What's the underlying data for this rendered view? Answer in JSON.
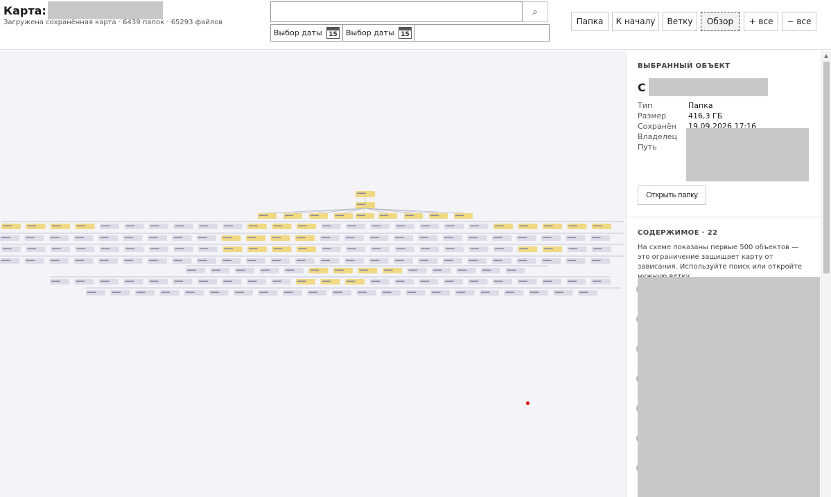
{
  "header": {
    "title": "Карта:",
    "subtitle": "Загружена сохранённая карта · 6439 папок · 65293 файлов",
    "search": {
      "value": "",
      "placeholder": "",
      "button_icon": "search-icon",
      "button_glyph": "⌕"
    },
    "date_from": {
      "label": "Выбор даты",
      "icon": "calendar-icon",
      "day": "15"
    },
    "date_to": {
      "label": "Выбор даты",
      "icon": "calendar-icon",
      "day": "15"
    }
  },
  "toolbar": {
    "buttons": [
      {
        "id": "folder",
        "label": "Папка"
      },
      {
        "id": "home",
        "label": "К началу"
      },
      {
        "id": "branch",
        "label": "Ветку"
      },
      {
        "id": "overview",
        "label": "Обзор",
        "active": true
      },
      {
        "id": "expand_all",
        "label": "+ все"
      },
      {
        "id": "collapse_all",
        "label": "− все"
      }
    ]
  },
  "selected": {
    "heading": "ВЫБРАННЫЙ ОБЪЕКТ",
    "name_initial": "С",
    "type_label": "Тип",
    "type_value": "Папка",
    "size_label": "Размер",
    "size_value": "416,3 ГБ",
    "saved_label": "Сохранён",
    "saved_value": "19.09.2026 17:16",
    "owner_label": "Владелец",
    "path_label": "Путь",
    "open_button": "Открыть папку"
  },
  "contents": {
    "heading": "СОДЕРЖИМОЕ · 22",
    "note": "На схеме показаны первые 500 объектов — это ограничение защищает карту от зависания. Используйте поиск или откройте нужную ветку."
  },
  "colors": {
    "folder_highlight": "#f0d982",
    "node": "#dcdce9",
    "canvas": "#f3f3f8",
    "marker": "#e00000"
  }
}
